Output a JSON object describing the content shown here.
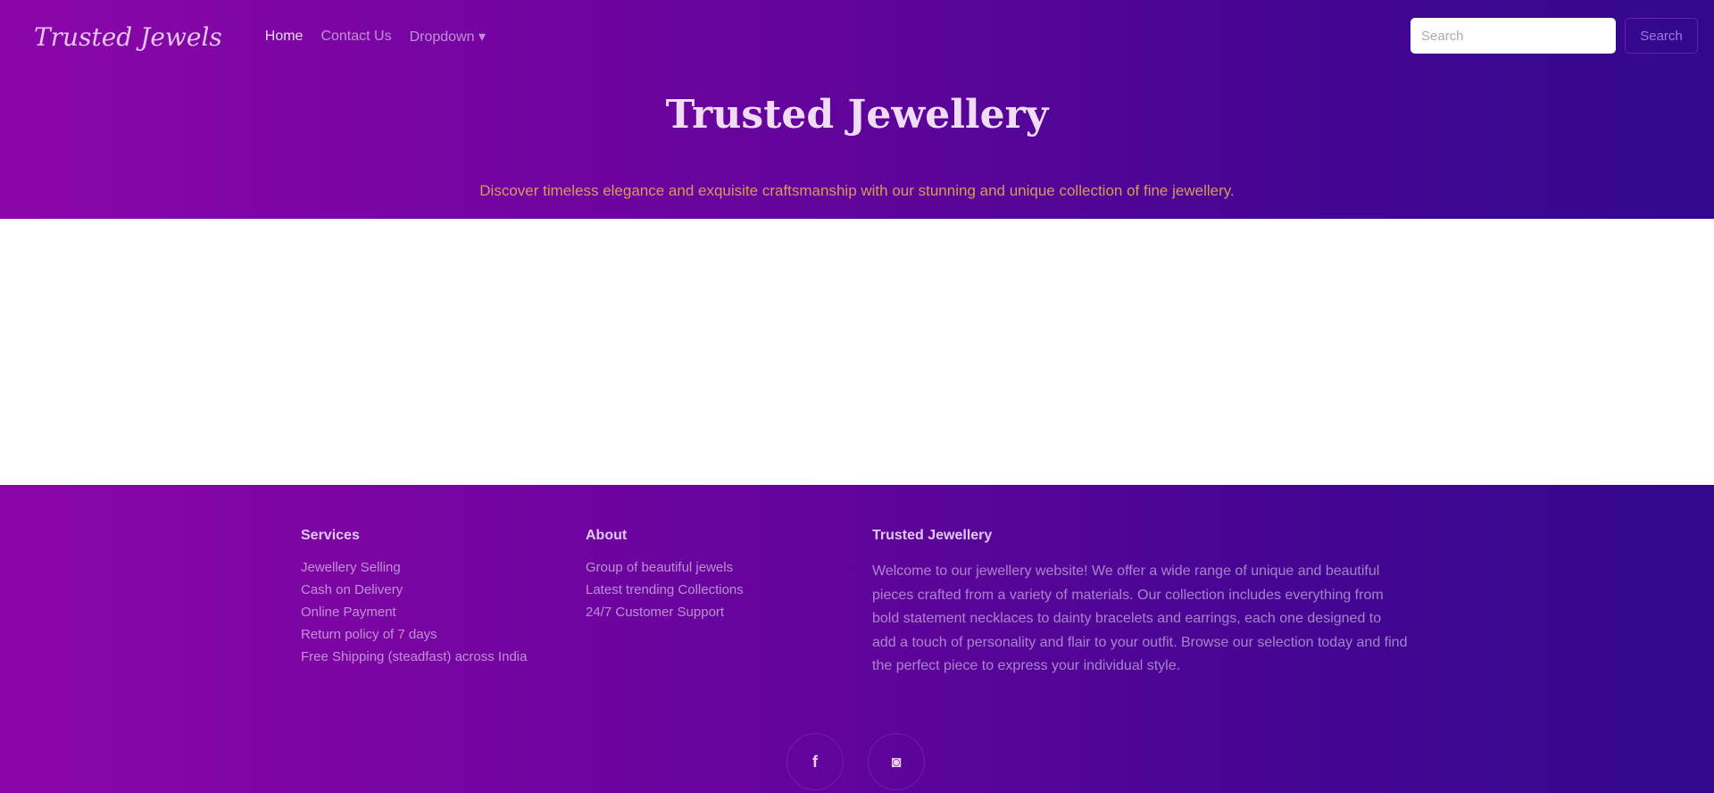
{
  "nav": {
    "brand": "Trusted Jewels",
    "links": [
      "Home",
      "Contact Us",
      "Dropdown ▾"
    ],
    "search_placeholder": "Search",
    "search_button": "Search"
  },
  "hero": {
    "title": "Trusted Jewellery",
    "tagline": "Discover timeless elegance and exquisite craftsmanship with our stunning and unique collection of fine jewellery."
  },
  "footer": {
    "services": {
      "title": "Services",
      "items": [
        "Jewellery Selling",
        "Cash on Delivery",
        "Online Payment",
        "Return policy of 7 days",
        "Free Shipping (steadfast) across India"
      ]
    },
    "about": {
      "title": "About",
      "items": [
        "Group of beautiful jewels",
        "Latest trending Collections",
        "24/7 Customer Support"
      ]
    },
    "brand": {
      "title": "Trusted Jewellery",
      "text": "Welcome to our jewellery website! We offer a wide range of unique and beautiful pieces crafted from a variety of materials. Our collection includes everything from bold statement necklaces to dainty bracelets and earrings, each one designed to add a touch of personality and flair to your outfit. Browse our selection today and find the perfect piece to express your individual style."
    },
    "social": {
      "facebook": "f",
      "instagram": "◙"
    }
  }
}
